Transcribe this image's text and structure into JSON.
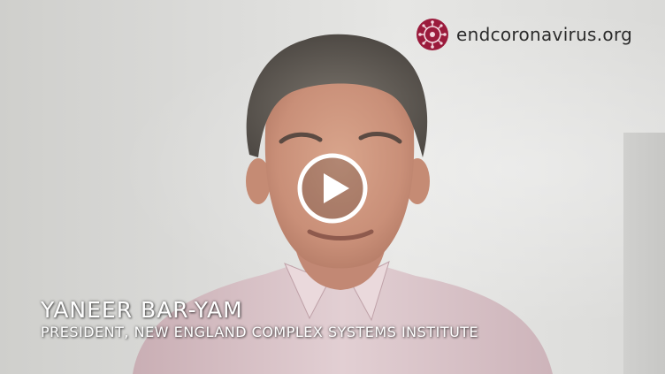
{
  "brand": {
    "site": "endcoronavirus.org",
    "logo_icon": "virus-emblem-icon",
    "logo_color": "#9b1b3c"
  },
  "video": {
    "play_icon": "play-icon"
  },
  "lower_third": {
    "name": "YANEER BAR-YAM",
    "title": "PRESIDENT, NEW ENGLAND COMPLEX SYSTEMS INSTITUTE"
  }
}
